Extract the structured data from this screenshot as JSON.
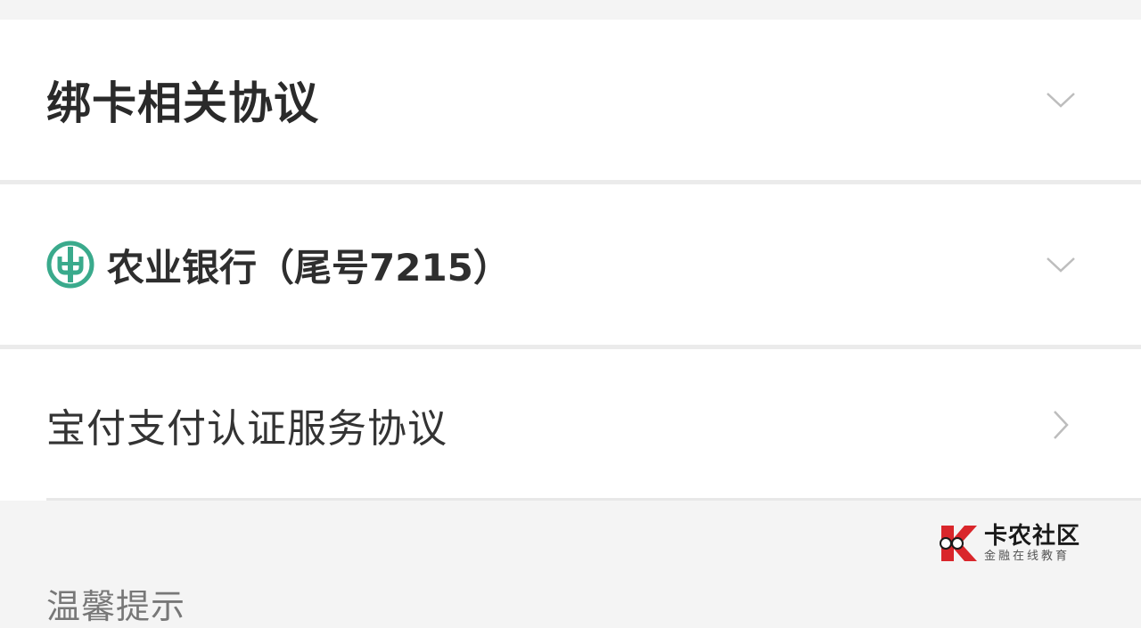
{
  "sections": {
    "binding_agreements": {
      "title": "绑卡相关协议",
      "icon": "chevron-down-icon"
    },
    "bank_card": {
      "bank_name": "农业银行（尾号7215）",
      "logo_icon": "abc-bank-logo-icon",
      "logo_color": "#3aaa8c",
      "icon": "chevron-down-icon"
    },
    "service_agreement": {
      "title": "宝付支付认证服务协议",
      "icon": "chevron-right-icon"
    }
  },
  "tips": {
    "title": "温馨提示"
  },
  "watermark": {
    "main": "卡农社区",
    "sub": "金融在线教育",
    "logo_color": "#d9262b"
  }
}
